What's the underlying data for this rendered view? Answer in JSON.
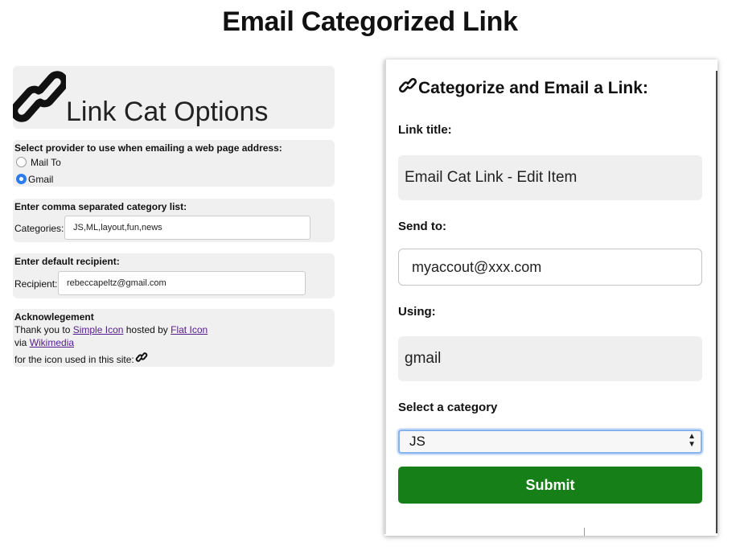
{
  "slide": {
    "title": "Email Categorized Link"
  },
  "options": {
    "title": "Link Cat Options",
    "provider": {
      "heading": "Select provider to use when emailing a web page address:",
      "options": [
        "Mail To",
        "Gmail"
      ],
      "selected": "Gmail"
    },
    "categories": {
      "heading": "Enter comma separated category list:",
      "label": "Categories:",
      "value": "JS,ML,layout,fun,news"
    },
    "recipient": {
      "heading": "Enter default recipient:",
      "label": "Recipient:",
      "value": "rebeccapeltz@gmail.com"
    },
    "acknowledgement": {
      "heading": "Acknowlegement",
      "line1_prefix": "Thank you to ",
      "simple_icon_link": "Simple Icon",
      "line1_mid": " hosted by ",
      "flat_icon_link": "Flat Icon",
      "line2_prefix": "via ",
      "wikimedia_link": "Wikimedia",
      "line3": "for the icon used in this site:"
    }
  },
  "popup": {
    "title": "Categorize and Email a Link:",
    "link_title_label": "Link title:",
    "link_title_value": "Email Cat Link - Edit Item",
    "send_to_label": "Send to:",
    "send_to_value": "myaccout@xxx.com",
    "using_label": "Using:",
    "using_value": "gmail",
    "category_label": "Select a category",
    "category_selected": "JS",
    "submit_label": "Submit"
  },
  "colors": {
    "submit_green": "#177f17",
    "link_purple": "#551a8b",
    "radio_blue": "#2a7cf0"
  }
}
